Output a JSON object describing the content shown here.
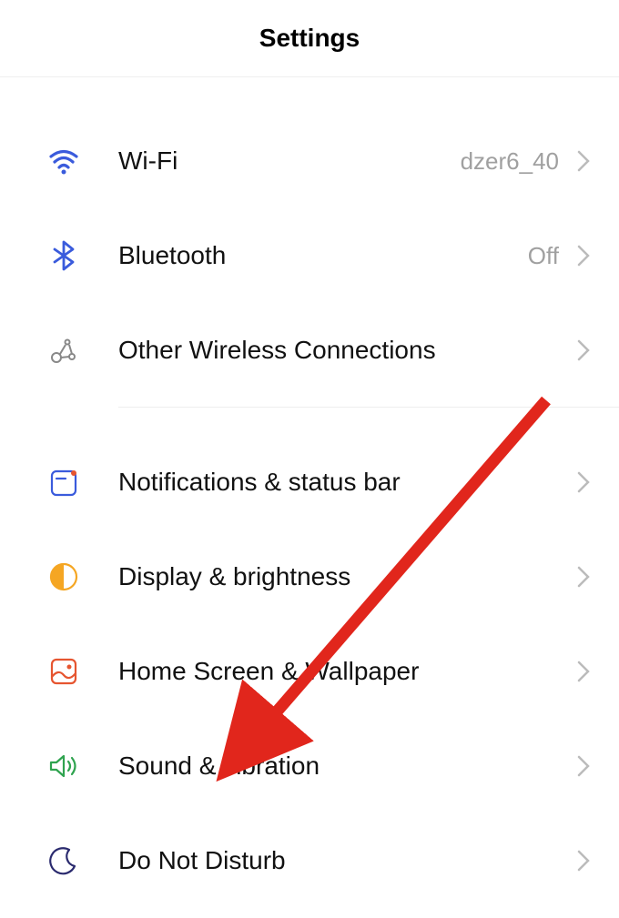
{
  "header": {
    "title": "Settings"
  },
  "groups": [
    {
      "items": [
        {
          "id": "wifi",
          "label": "Wi-Fi",
          "value": "dzer6_40",
          "icon": "wifi-icon"
        },
        {
          "id": "bluetooth",
          "label": "Bluetooth",
          "value": "Off",
          "icon": "bluetooth-icon"
        },
        {
          "id": "other-wireless",
          "label": "Other Wireless Connections",
          "value": "",
          "icon": "wireless-icon"
        }
      ]
    },
    {
      "items": [
        {
          "id": "notifications",
          "label": "Notifications & status bar",
          "value": "",
          "icon": "notification-icon"
        },
        {
          "id": "display",
          "label": "Display & brightness",
          "value": "",
          "icon": "display-icon"
        },
        {
          "id": "home-screen",
          "label": "Home Screen & Wallpaper",
          "value": "",
          "icon": "wallpaper-icon"
        },
        {
          "id": "sound",
          "label": "Sound & vibration",
          "value": "",
          "icon": "sound-icon"
        },
        {
          "id": "dnd",
          "label": "Do Not Disturb",
          "value": "",
          "icon": "moon-icon"
        }
      ]
    }
  ]
}
